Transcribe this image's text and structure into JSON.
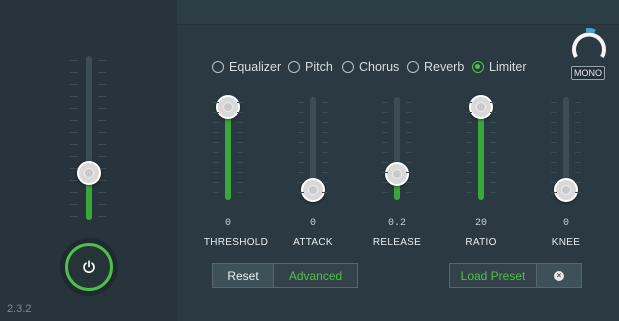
{
  "version": "2.3.2",
  "power_icon": "power-icon",
  "master": {
    "level": 0.29
  },
  "tabs": [
    {
      "label": "Equalizer",
      "selected": false
    },
    {
      "label": "Pitch",
      "selected": false
    },
    {
      "label": "Chorus",
      "selected": false
    },
    {
      "label": "Reverb",
      "selected": false
    },
    {
      "label": "Limiter",
      "selected": true
    }
  ],
  "mono": {
    "label": "MONO",
    "level": 0.2
  },
  "sliders": [
    {
      "label": "THRESHOLD",
      "value": "0",
      "level": 1.0
    },
    {
      "label": "ATTACK",
      "value": "0",
      "level": 0.0
    },
    {
      "label": "RELEASE",
      "value": "0.2",
      "level": 0.2
    },
    {
      "label": "RATIO",
      "value": "20",
      "level": 1.0
    },
    {
      "label": "KNEE",
      "value": "0",
      "level": 0.0
    }
  ],
  "buttons": {
    "reset": "Reset",
    "advanced": "Advanced",
    "load_preset": "Load Preset",
    "close_icon": "close-icon"
  },
  "colors": {
    "accent": "#4ec04a",
    "background": "#2b3a42",
    "mono_indicator": "#3fa7d6"
  }
}
